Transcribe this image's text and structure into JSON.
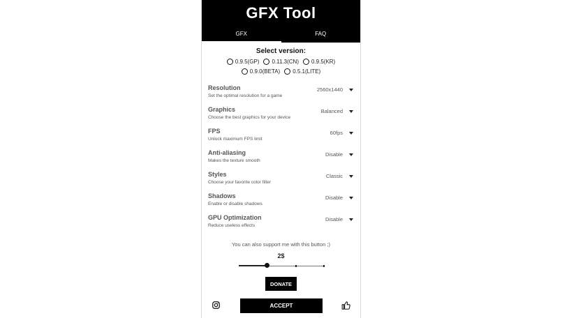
{
  "app": {
    "title": "GFX Tool"
  },
  "tabs": [
    {
      "label": "GFX"
    },
    {
      "label": "FAQ"
    }
  ],
  "version": {
    "title": "Select version:",
    "options_row1": [
      "0.9.5(GP)",
      "0.11.3(CN)",
      "0.9.5(KR)"
    ],
    "options_row2": [
      "0.9.0(BETA)",
      "0.5.1(LITE)"
    ]
  },
  "settings": [
    {
      "label": "Resolution",
      "desc": "Set the optimal resolution for a game",
      "value": "2560x1440"
    },
    {
      "label": "Graphics",
      "desc": "Choose the best graphics for your device",
      "value": "Balanced"
    },
    {
      "label": "FPS",
      "desc": "Unlock maximum FPS limit",
      "value": "60fps"
    },
    {
      "label": "Anti-aliasing",
      "desc": "Makes the texture smooth",
      "value": "Disable"
    },
    {
      "label": "Styles",
      "desc": "Choose your favorite color filter",
      "value": "Classic"
    },
    {
      "label": "Shadows",
      "desc": "Enable or disable shadows",
      "value": "Disable"
    },
    {
      "label": "GPU Optimization",
      "desc": "Reduce useless effects",
      "value": "Disable"
    }
  ],
  "support": {
    "text": "You can also support me with this button ;)",
    "amount": "2$",
    "slider_fraction": 0.33,
    "donate_label": "DONATE"
  },
  "footer": {
    "accept_label": "ACCEPT",
    "left_icon": "instagram-icon",
    "right_icon": "thumbs-up-icon"
  }
}
